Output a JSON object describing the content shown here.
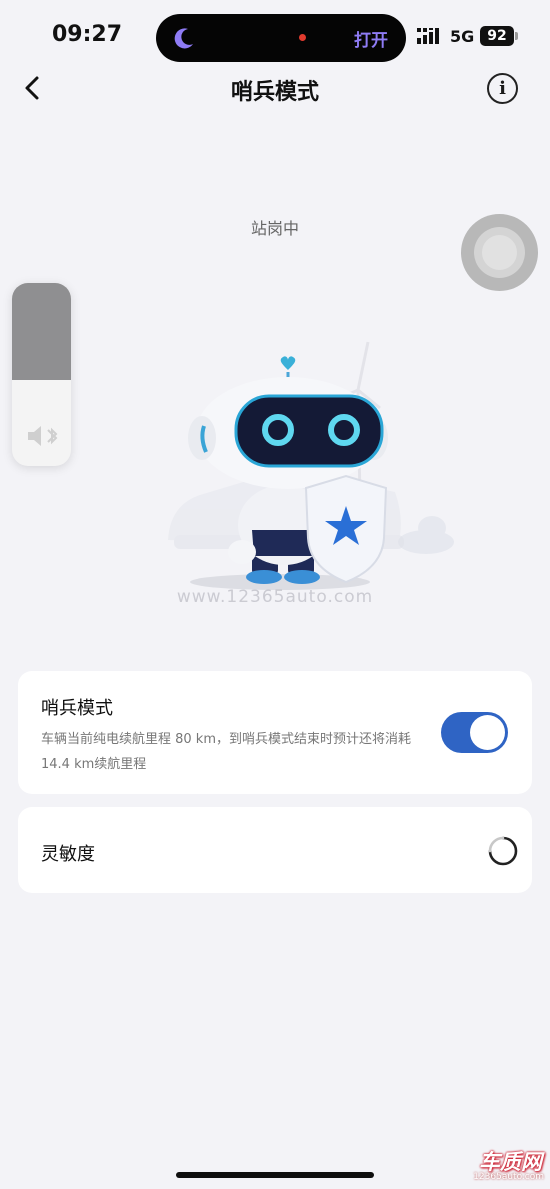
{
  "status_bar": {
    "time": "09:27",
    "island_action": "打开",
    "network": "5G",
    "battery": "92",
    "icons": [
      "moon-icon",
      "signal-icon"
    ]
  },
  "nav": {
    "title": "哨兵模式",
    "back_icon": "chevron-left-icon",
    "info_icon": "info-icon",
    "info_glyph": "i"
  },
  "stage": {
    "status_text": "站岗中",
    "watermark": "www.12365auto.com",
    "volume_level": 0.53
  },
  "sentry_card": {
    "title": "哨兵模式",
    "description": "车辆当前纯电续航里程 80 km，到哨兵模式结束时预计还将消耗14.4 km续航里程",
    "toggle_on": true
  },
  "sensitivity_card": {
    "label": "灵敏度",
    "loading_icon": "spinner-icon"
  },
  "corner_logo": {
    "brand": "车质网",
    "url": "12365auto.com"
  },
  "colors": {
    "accent": "#2f64c4",
    "background": "#f3f3f7",
    "card": "#ffffff",
    "mascot_eye": "#5fd8f0",
    "shield_star": "#2a6fd6"
  }
}
